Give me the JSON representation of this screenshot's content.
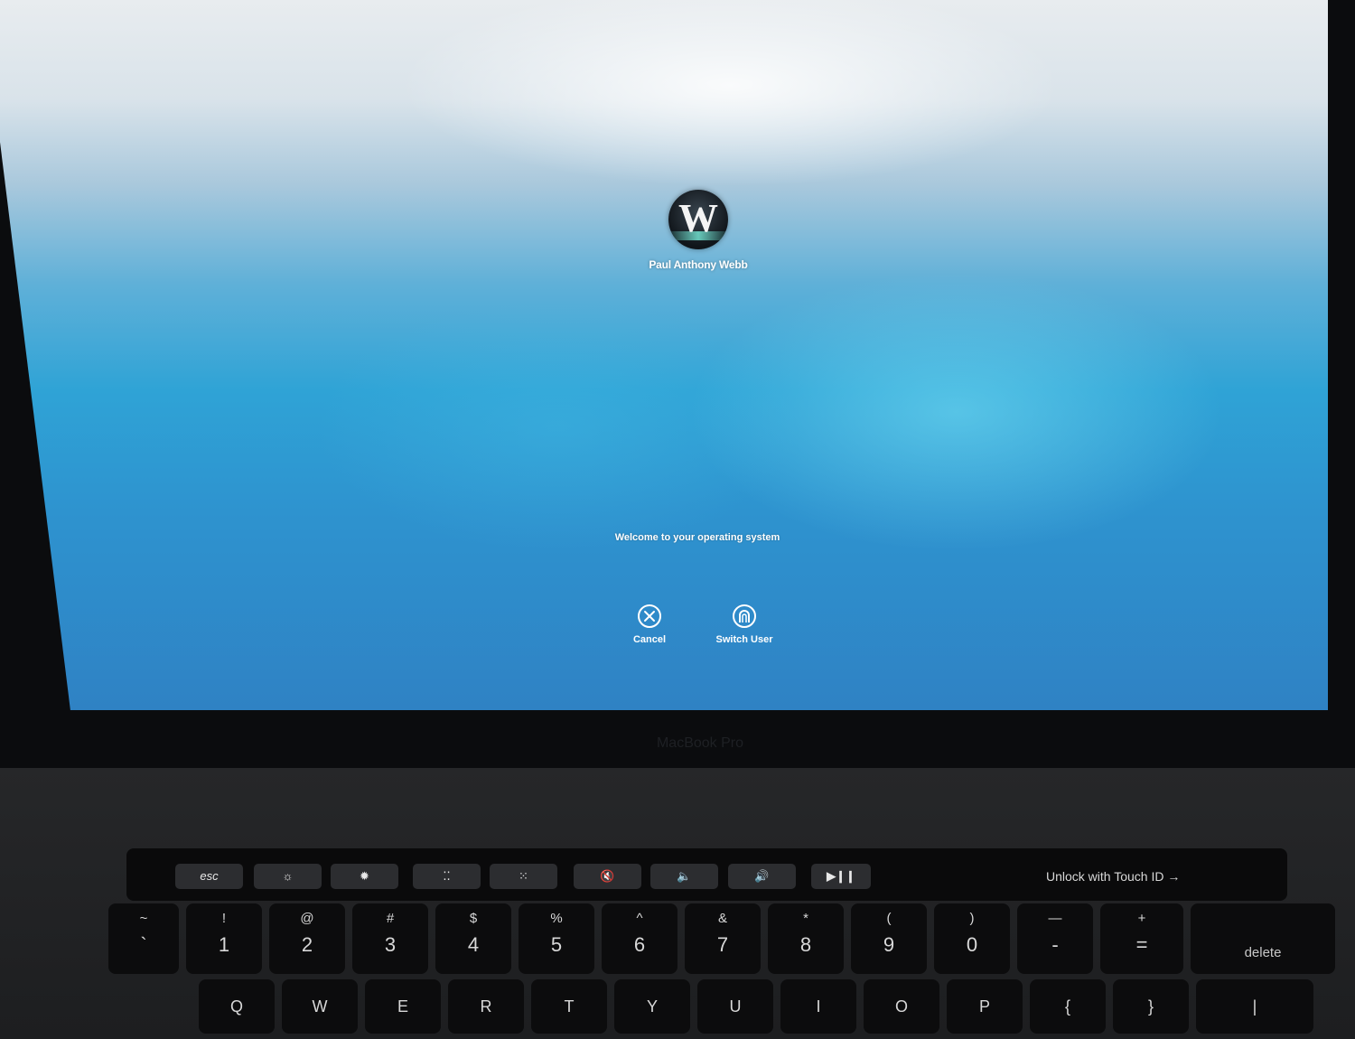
{
  "login": {
    "user_name": "Paul Anthony Webb",
    "avatar_letter": "W",
    "message": "Welcome to your operating system",
    "cancel_label": "Cancel",
    "switch_user_label": "Switch User"
  },
  "hardware": {
    "brand": "MacBook Pro"
  },
  "touchbar": {
    "esc_label": "esc",
    "unlock_label": "Unlock with Touch ID",
    "icons": [
      "brightness-down-icon",
      "brightness-up-icon",
      "keyboard-brightness-down-icon",
      "keyboard-brightness-up-icon",
      "mute-icon",
      "volume-down-icon",
      "volume-up-icon",
      "play-pause-icon",
      "arrow-right-icon"
    ]
  },
  "keyboard": {
    "number_row": [
      {
        "top": "~",
        "bottom": "`"
      },
      {
        "top": "!",
        "bottom": "1"
      },
      {
        "top": "@",
        "bottom": "2"
      },
      {
        "top": "#",
        "bottom": "3"
      },
      {
        "top": "$",
        "bottom": "4"
      },
      {
        "top": "%",
        "bottom": "5"
      },
      {
        "top": "^",
        "bottom": "6"
      },
      {
        "top": "&",
        "bottom": "7"
      },
      {
        "top": "*",
        "bottom": "8"
      },
      {
        "top": "(",
        "bottom": "9"
      },
      {
        "top": ")",
        "bottom": "0"
      },
      {
        "top": "—",
        "bottom": "-"
      },
      {
        "top": "+",
        "bottom": "="
      }
    ],
    "delete_label": "delete",
    "letter_row": [
      "Q",
      "W",
      "E",
      "R",
      "T",
      "Y",
      "U",
      "I",
      "O",
      "P",
      "{",
      "}",
      "|"
    ]
  },
  "colors": {
    "accent_blue": "#2fa3d6",
    "text_white": "#ffffff"
  }
}
